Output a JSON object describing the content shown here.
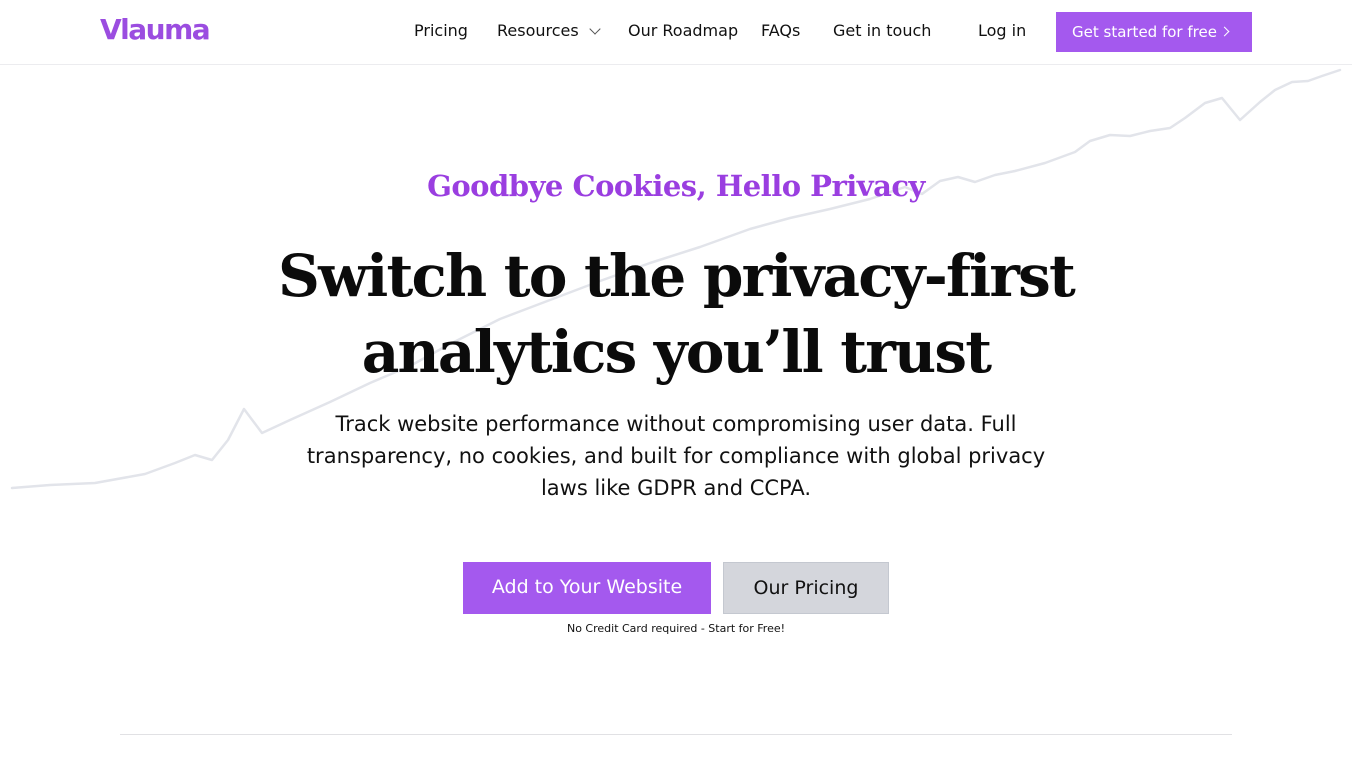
{
  "colors": {
    "brand": "#9b4de0",
    "eyebrow": "#9a3ee0",
    "primary_button": "#a459ee",
    "secondary_button": "#d4d6dc",
    "trend_line": "#e2e4ea"
  },
  "header": {
    "logo": "Vlauma",
    "nav": {
      "pricing": "Pricing",
      "resources": "Resources",
      "roadmap": "Our Roadmap",
      "faqs": "FAQs",
      "contact": "Get in touch"
    },
    "login": "Log in",
    "cta": "Get started for free",
    "icons": {
      "resources_dropdown": "chevron-down-icon",
      "cta_arrow": "chevron-right-icon"
    }
  },
  "hero": {
    "eyebrow": "Goodbye Cookies, Hello Privacy",
    "headline_line1": "Switch to the privacy-first",
    "headline_line2": "analytics you’ll trust",
    "subtitle": "Track website performance without compromising user data. Full transparency, no cookies, and built for compliance with global privacy laws like GDPR and CCPA.",
    "primary_button": "Add to Your Website",
    "secondary_button": "Our Pricing",
    "note": "No Credit Card required - Start for Free!"
  }
}
